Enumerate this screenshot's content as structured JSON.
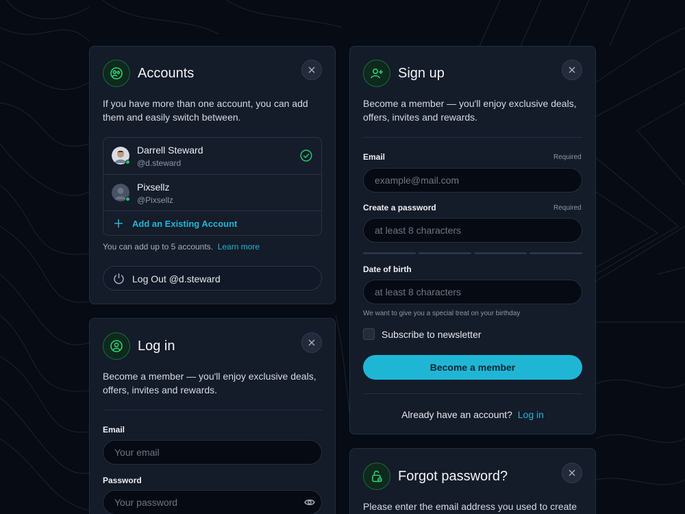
{
  "colors": {
    "accent": "#22b8d8",
    "success": "#25c26e",
    "background": "#070b13",
    "card": "#141b29"
  },
  "accounts": {
    "title": "Accounts",
    "icon": "account-switch-icon",
    "description_line1": "If you have more than one account, you can add",
    "description_line2": "them and easily switch between.",
    "list": [
      {
        "name": "Darrell Steward",
        "handle": "@d.steward",
        "selected": true
      },
      {
        "name": "Pixsellz",
        "handle": "@Pixsellz",
        "selected": false
      }
    ],
    "add_label": "Add an Existing Account",
    "limit_text": "You can add up to 5 accounts.",
    "learn_more": "Learn more",
    "logout_label": "Log Out @d.steward"
  },
  "login": {
    "title": "Log in",
    "icon": "user-icon",
    "description_line1": "Become a member — you'll enjoy exclusive deals,",
    "description_line2": "offers, invites and rewards.",
    "email_label": "Email",
    "email_placeholder": "Your email",
    "password_label": "Password",
    "password_placeholder": "Your password"
  },
  "signup": {
    "title": "Sign up",
    "icon": "add-user-icon",
    "description_line1": "Become a member — you'll enjoy exclusive deals,",
    "description_line2": "offers, invites and rewards.",
    "email_label": "Email",
    "email_required": "Required",
    "email_placeholder": "example@mail.com",
    "password_label": "Create a password",
    "password_required": "Required",
    "password_placeholder": "at least 8 characters",
    "password_strength_segments": 4,
    "dob_label": "Date of birth",
    "dob_placeholder": "at least 8 characters",
    "dob_hint": "We want to give you a special treat on your birthday",
    "newsletter_label": "Subscribe to newsletter",
    "newsletter_checked": false,
    "submit_label": "Become a member",
    "footer_text": "Already have an account?",
    "footer_link": "Log in"
  },
  "forgot": {
    "title": "Forgot password?",
    "icon": "lock-icon",
    "description_line1": "Please enter the email address you used to create"
  }
}
